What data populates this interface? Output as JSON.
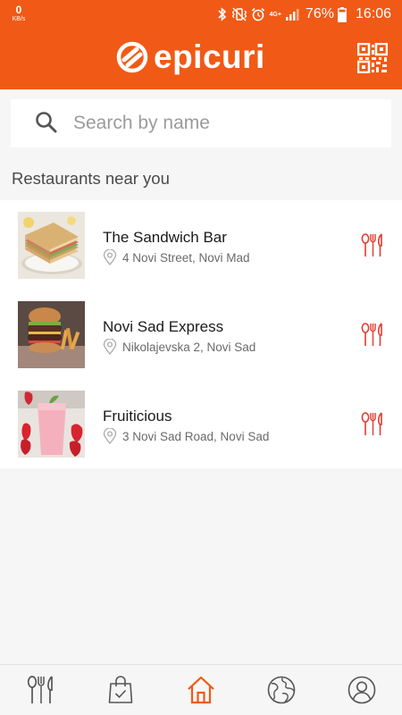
{
  "status_bar": {
    "net_speed_value": "0",
    "net_speed_unit": "KB/s",
    "network_type": "4G+",
    "battery_percent": "76%",
    "time": "16:06",
    "icons": [
      "bluetooth-icon",
      "vibrate-icon",
      "alarm-icon",
      "signal-icon",
      "battery-icon"
    ]
  },
  "header": {
    "brand": "epicuri",
    "brand_color": "#f05a16",
    "qr_icon": "qr-code-icon"
  },
  "search": {
    "placeholder": "Search by name",
    "value": ""
  },
  "section_title": "Restaurants near you",
  "restaurants": [
    {
      "name": "The Sandwich Bar",
      "address": "4 Novi Street, Novi Mad",
      "image": "sandwich-image"
    },
    {
      "name": "Novi Sad Express",
      "address": "Nikolajevska 2, Novi Sad",
      "image": "burger-image"
    },
    {
      "name": "Fruiticious",
      "address": "3 Novi Sad Road, Novi Sad",
      "image": "smoothie-image"
    }
  ],
  "bottom_nav": {
    "items": [
      "restaurants-tab",
      "orders-tab",
      "home-tab",
      "explore-tab",
      "profile-tab"
    ],
    "active": "home-tab",
    "active_color": "#f05a16",
    "inactive_color": "#555555"
  }
}
